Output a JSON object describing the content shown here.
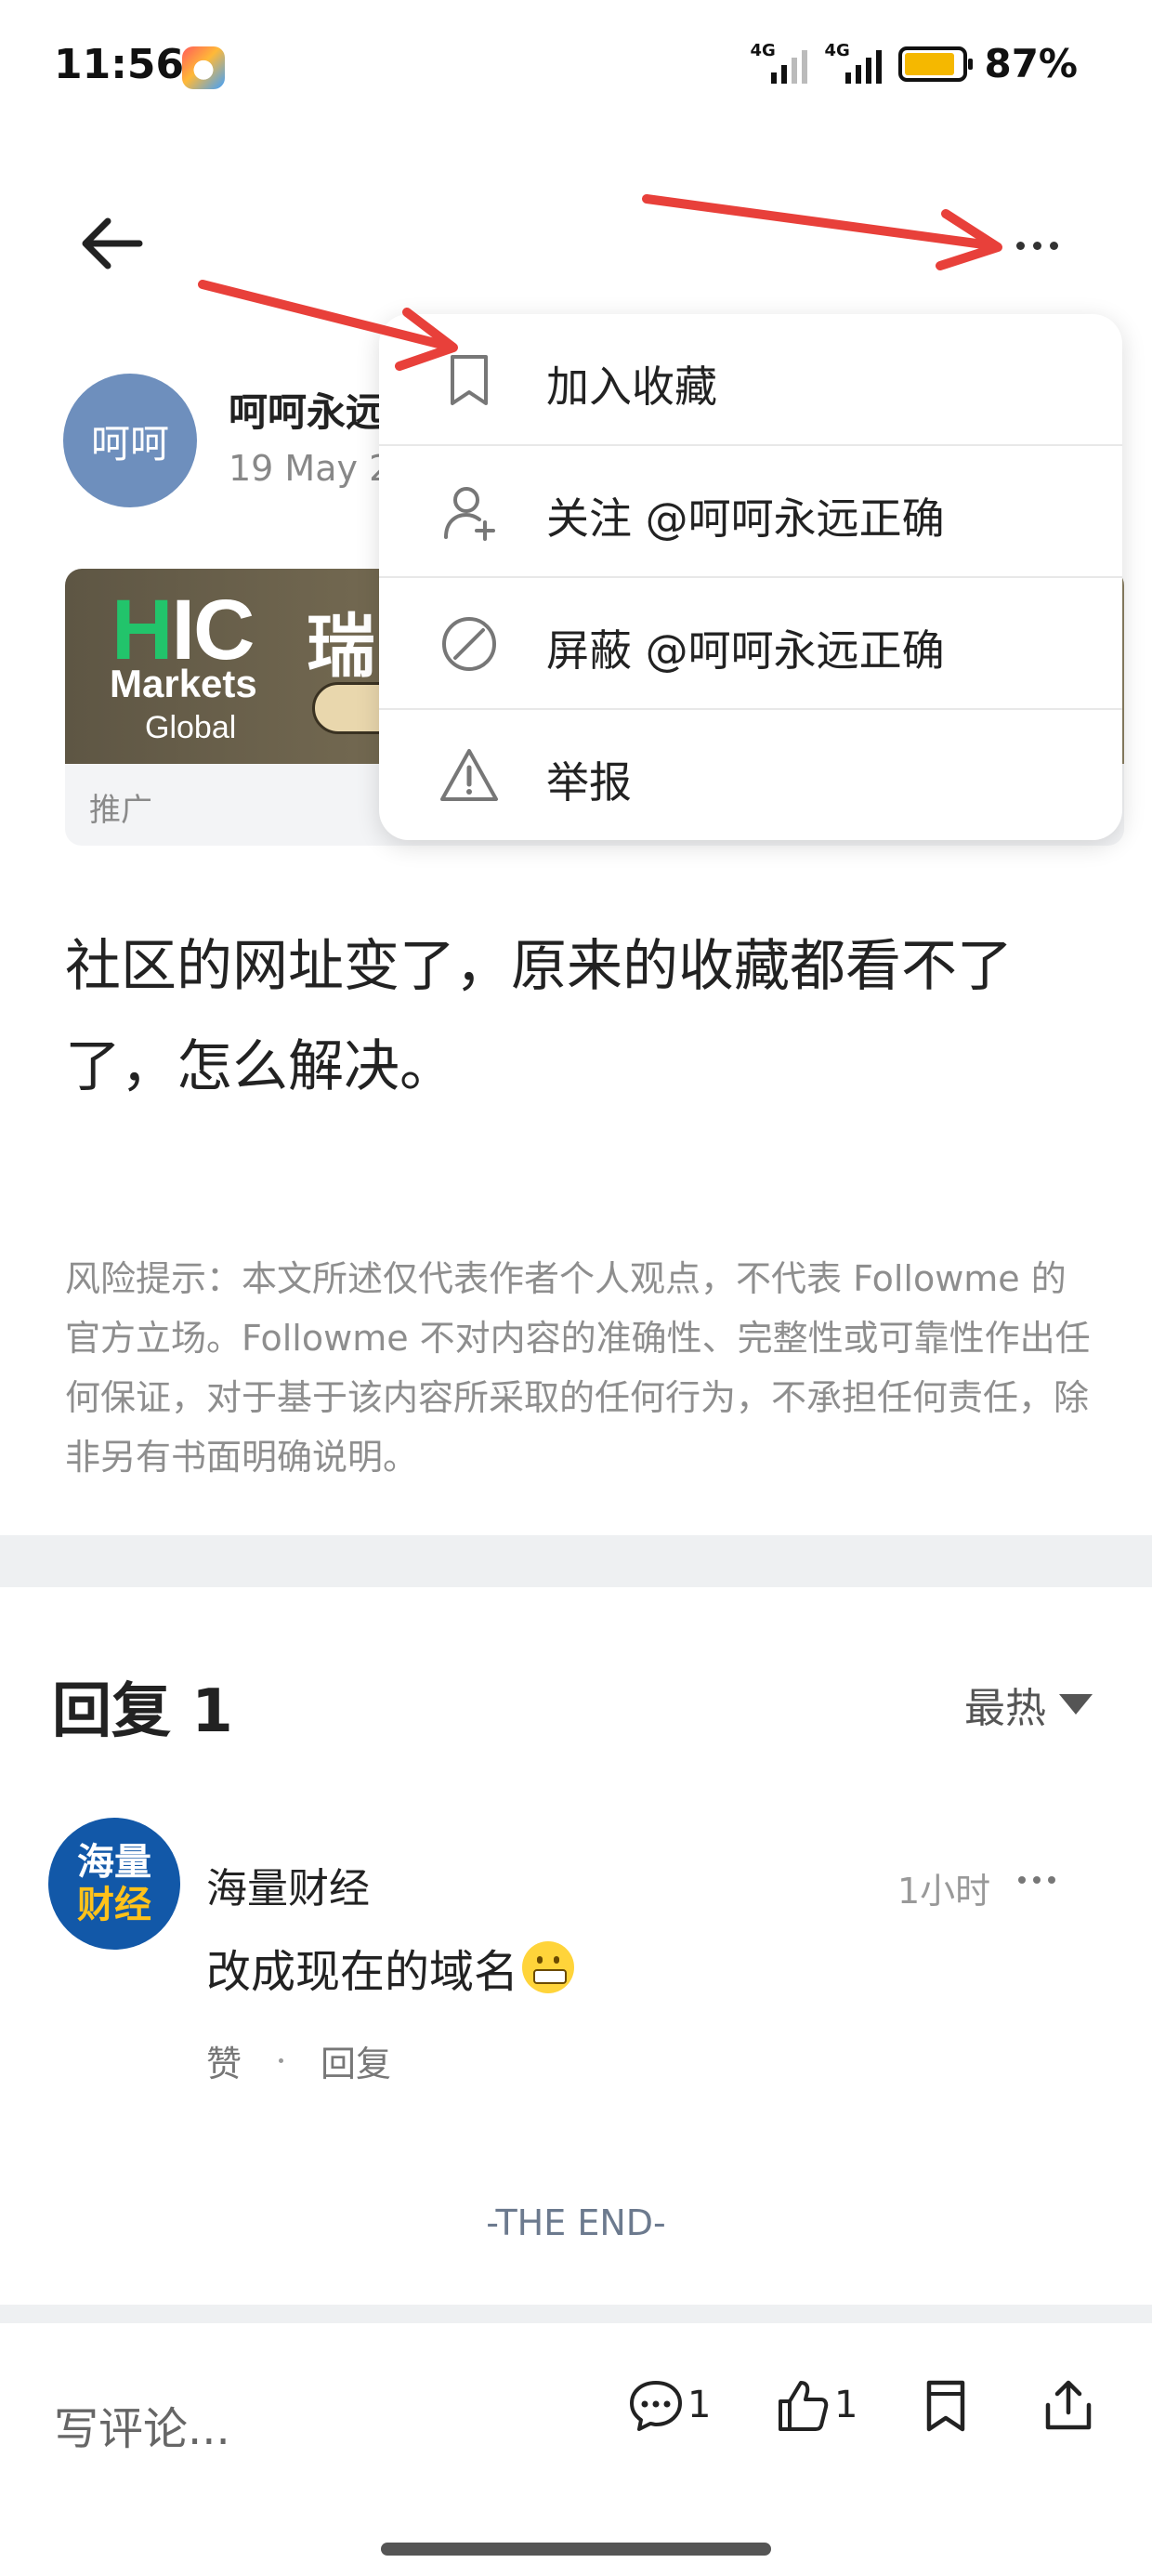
{
  "status_bar": {
    "time": "11:56",
    "network1": "4G",
    "network2": "4G",
    "battery_percent": "87%",
    "battery_level": 0.87
  },
  "nav": {
    "back_icon": "arrow-left-icon",
    "more_icon": "more-horizontal-icon"
  },
  "author": {
    "avatar_text": "呵呵",
    "name": "呵呵永远",
    "date": "19 May 2"
  },
  "ad": {
    "logo_hic": "IC",
    "logo_h": "H",
    "logo_markets": "Markets",
    "logo_global": "Global",
    "headline": "瑞",
    "label": "推广"
  },
  "menu": {
    "items": [
      {
        "label": "加入收藏",
        "icon": "bookmark-icon"
      },
      {
        "label": "关注 @呵呵永远正确",
        "icon": "follow-user-icon"
      },
      {
        "label": "屏蔽 @呵呵永远正确",
        "icon": "block-icon"
      },
      {
        "label": "举报",
        "icon": "warning-icon"
      }
    ]
  },
  "post": {
    "body_line1": "社区的网址变了，原来的收藏都看不了",
    "body_line2": "了，怎么解决。",
    "disclaimer": "风险提示：本文所述仅代表作者个人观点，不代表 Followme 的官方立场。Followme 不对内容的准确性、完整性或可靠性作出任何保证，对于基于该内容所采取的任何行为，不承担任何责任，除非另有书面明确说明。"
  },
  "replies": {
    "title": "回复 1",
    "sort_label": "最热",
    "comments": [
      {
        "avatar_line1": "海量",
        "avatar_line2": "财经",
        "name": "海量财经",
        "time": "1小时",
        "text": "改成现在的域名",
        "like_label": "赞",
        "reply_label": "回复"
      }
    ]
  },
  "footer": {
    "end_text": "-THE END-"
  },
  "bottom_bar": {
    "comment_placeholder": "写评论...",
    "comment_count": "1",
    "like_count": "1"
  },
  "colors": {
    "annotation_arrow": "#e8403a",
    "avatar_main": "#6e8fbd",
    "brand_blue": "#1258a8"
  }
}
